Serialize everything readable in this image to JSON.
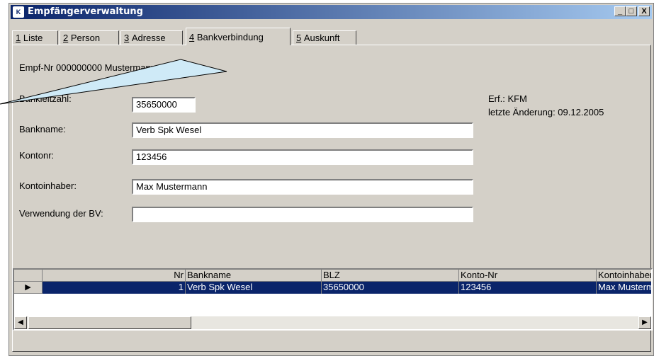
{
  "window": {
    "title": "Empfängerverwaltung",
    "icon": "app-icon",
    "icon_text": "K"
  },
  "tabs": [
    {
      "number": "1",
      "label": "Liste"
    },
    {
      "number": "2",
      "label": "Person"
    },
    {
      "number": "3",
      "label": "Adresse"
    },
    {
      "number": "4",
      "label": "Bankverbindung"
    },
    {
      "number": "5",
      "label": "Auskunft"
    }
  ],
  "active_tab": 3,
  "header": {
    "record_line": "Empf-Nr 000000000 Mustermann, Max"
  },
  "form": {
    "blz_label": "Bankleitzahl:",
    "blz_value": "35650000",
    "bankname_label": "Bankname:",
    "bankname_value": "Verb Spk Wesel",
    "kontonr_label": "Kontonr:",
    "kontonr_value": "123456",
    "inhaber_label": "Kontoinhaber:",
    "inhaber_value": "Max Mustermann",
    "verwendung_label": "Verwendung der BV:",
    "verwendung_value": ""
  },
  "meta": {
    "erf": "Erf.: KFM",
    "aenderung": "letzte Änderung: 09.12.2005"
  },
  "table": {
    "columns": [
      "Nr",
      "Bankname",
      "BLZ",
      "Konto-Nr",
      "Kontoinhaber"
    ],
    "rows": [
      [
        "1",
        "Verb Spk Wesel",
        "35650000",
        "123456",
        "Max Mustermann"
      ]
    ]
  },
  "buttons": {
    "minimize": "_",
    "maximize": "□",
    "close": "X",
    "scroll_left": "◀",
    "scroll_right": "▶",
    "row_indicator": "▶"
  }
}
